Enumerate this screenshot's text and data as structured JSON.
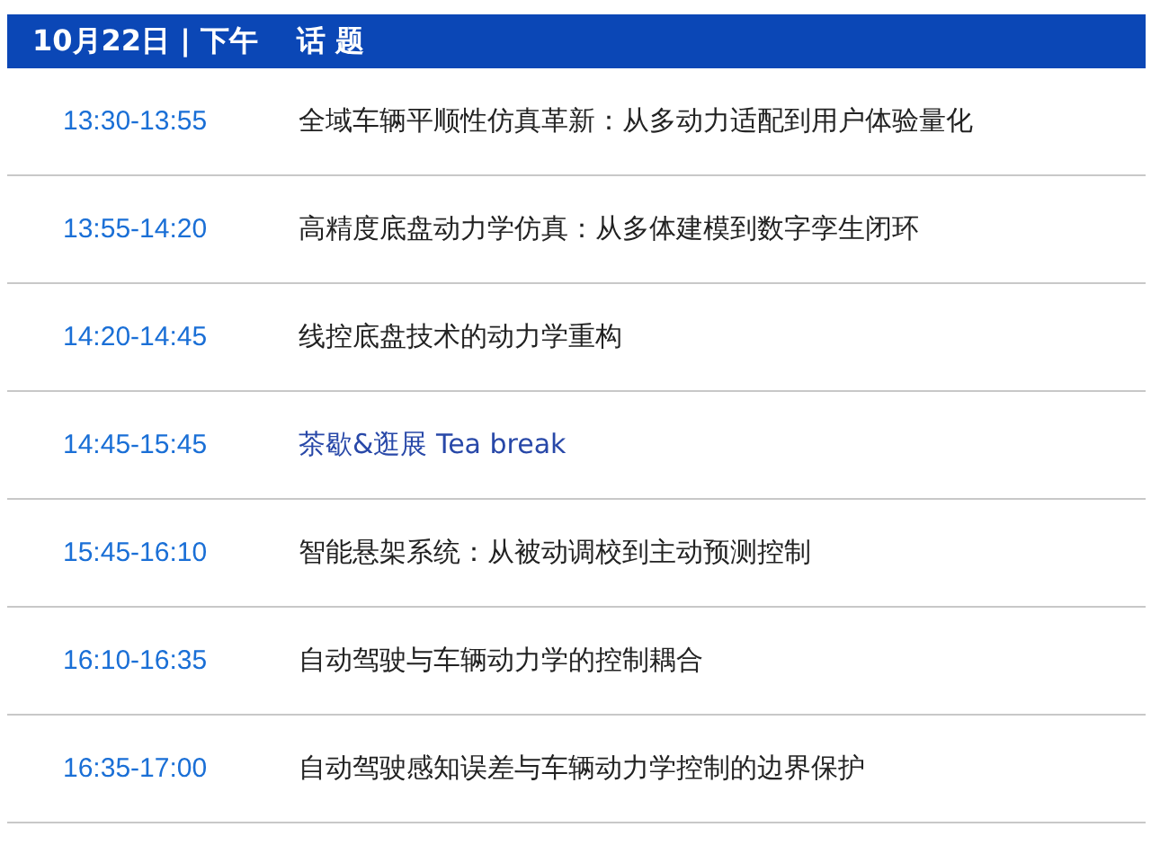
{
  "header": {
    "date_session": "10月22日 | 下午",
    "topic_heading": "话 题"
  },
  "rows": [
    {
      "time": "13:30-13:55",
      "topic": "全域车辆平顺性仿真革新：从多动力适配到用户体验量化",
      "kind": "talk"
    },
    {
      "time": "13:55-14:20",
      "topic": "高精度底盘动力学仿真：从多体建模到数字孪生闭环",
      "kind": "talk"
    },
    {
      "time": "14:20-14:45",
      "topic": "线控底盘技术的动力学重构",
      "kind": "talk"
    },
    {
      "time": "14:45-15:45",
      "topic": "茶歇&逛展 Tea break",
      "kind": "break"
    },
    {
      "time": "15:45-16:10",
      "topic": "智能悬架系统：从被动调校到主动预测控制",
      "kind": "talk"
    },
    {
      "time": "16:10-16:35",
      "topic": "自动驾驶与车辆动力学的控制耦合",
      "kind": "talk"
    },
    {
      "time": "16:35-17:00",
      "topic": "自动驾驶感知误差与车辆动力学控制的边界保护",
      "kind": "talk"
    }
  ]
}
